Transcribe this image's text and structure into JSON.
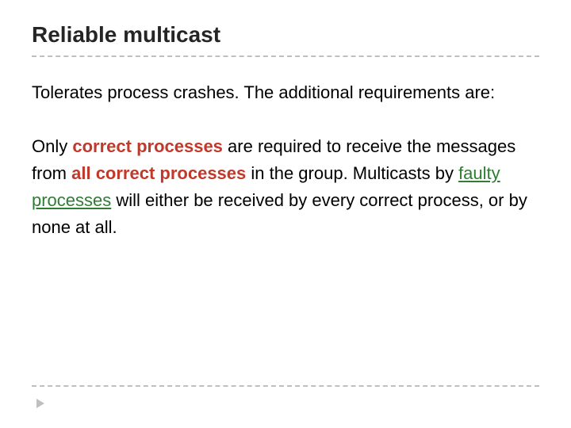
{
  "title": "Reliable multicast",
  "para1": "Tolerates process crashes. The additional requirements are:",
  "p2": {
    "t1": "Only ",
    "s1": "correct processes",
    "t2": " are required to receive the messages from ",
    "s2": "all correct processes",
    "t3": " in the group. Multicasts by ",
    "s3": "faulty processes",
    "t4": " will either be received by every correct process, or by none at all."
  }
}
